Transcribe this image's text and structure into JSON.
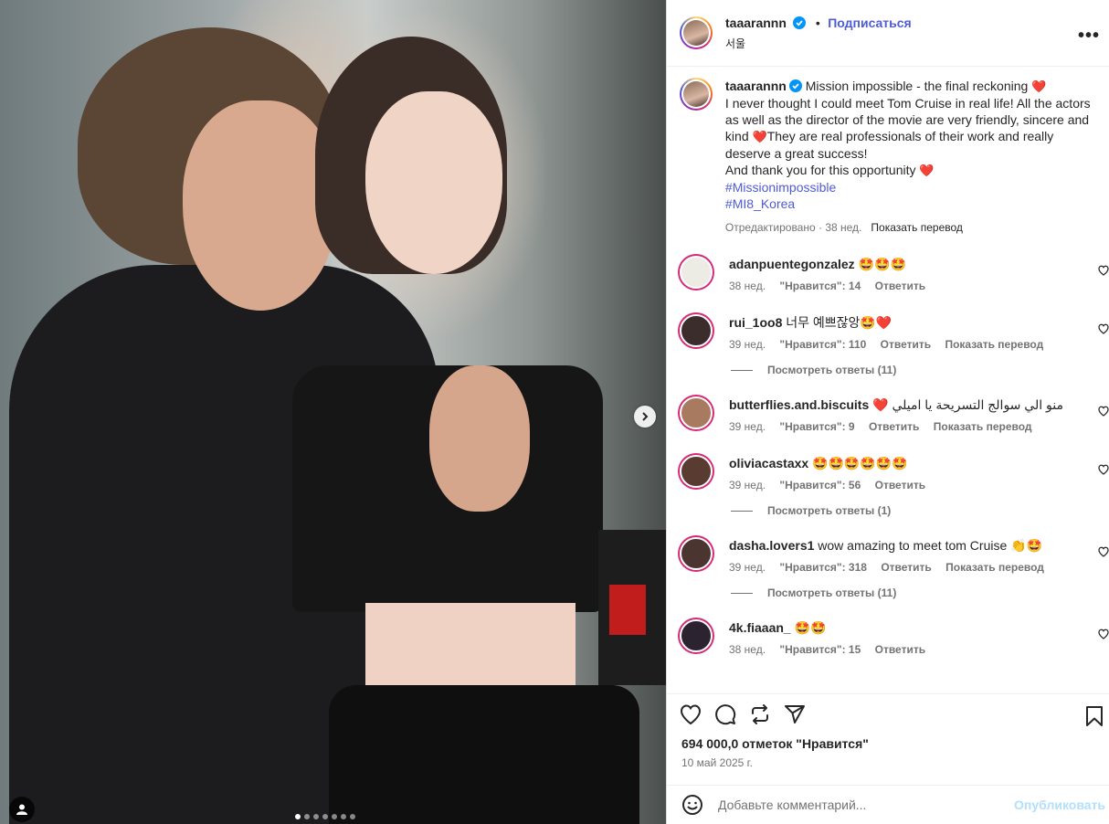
{
  "post": {
    "username": "taaarannn",
    "follow_label": "Подписаться",
    "separator": "•",
    "location": "서울",
    "more_label": "•••",
    "photo_alt": "",
    "carousel_count": 7,
    "carousel_active": 0
  },
  "caption": {
    "username": "taaarannn",
    "line1": " Mission impossible - the final reckoning ",
    "line2": "I never thought I could meet Tom Cruise in real life! All the actors as well as the director of the movie are very friendly, sincere and kind ",
    "line3": "They are real professionals of their work and really deserve a great success!",
    "line4": "And thank you for this opportunity ",
    "hashtag1": "#Missionimpossible",
    "hashtag2": "#MI8_Korea",
    "edited": "Отредактировано · 38 нед.",
    "translate": "Показать перевод"
  },
  "comments": [
    {
      "username": "adanpuentegonzalez",
      "text": "🤩🤩🤩",
      "age": "38 нед.",
      "likes": "\"Нравится\": 14",
      "reply": "Ответить",
      "translate": "",
      "replies": "",
      "avatar_color": "#ecebe4"
    },
    {
      "username": "rui_1oo8",
      "text": "너무 예쁘잖앙🤩❤️",
      "age": "39 нед.",
      "likes": "\"Нравится\": 110",
      "reply": "Ответить",
      "translate": "Показать перевод",
      "replies": "Посмотреть ответы (11)",
      "avatar_color": "#3a2d2b"
    },
    {
      "username": "butterflies.and.biscuits",
      "text": "❤️ منو الي سوالج التسريحة يا اميلي",
      "age": "39 нед.",
      "likes": "\"Нравится\": 9",
      "reply": "Ответить",
      "translate": "Показать перевод",
      "replies": "",
      "avatar_color": "#a87a5f"
    },
    {
      "username": "oliviacastaxx",
      "text": "🤩🤩🤩🤩🤩🤩",
      "age": "39 нед.",
      "likes": "\"Нравится\": 56",
      "reply": "Ответить",
      "translate": "",
      "replies": "Посмотреть ответы (1)",
      "avatar_color": "#5a3b31"
    },
    {
      "username": "dasha.lovers1",
      "text": "wow amazing to meet tom Cruise 👏🤩",
      "age": "39 нед.",
      "likes": "\"Нравится\": 318",
      "reply": "Ответить",
      "translate": "Показать перевод",
      "replies": "Посмотреть ответы (11)",
      "avatar_color": "#4a3530"
    },
    {
      "username": "4k.fiaaan_",
      "text": "🤩🤩",
      "age": "38 нед.",
      "likes": "\"Нравится\": 15",
      "reply": "Ответить",
      "translate": "",
      "replies": "",
      "avatar_color": "#2b2430"
    }
  ],
  "footer": {
    "likes": "694 000,0 отметок \"Нравится\"",
    "date": "10 май 2025 г.",
    "comment_placeholder": "Добавьте комментарий...",
    "publish_label": "Опубликовать"
  },
  "colors": {
    "accent": "#4f5bd5",
    "verified": "#0095f6",
    "heart": "#ff3040"
  }
}
